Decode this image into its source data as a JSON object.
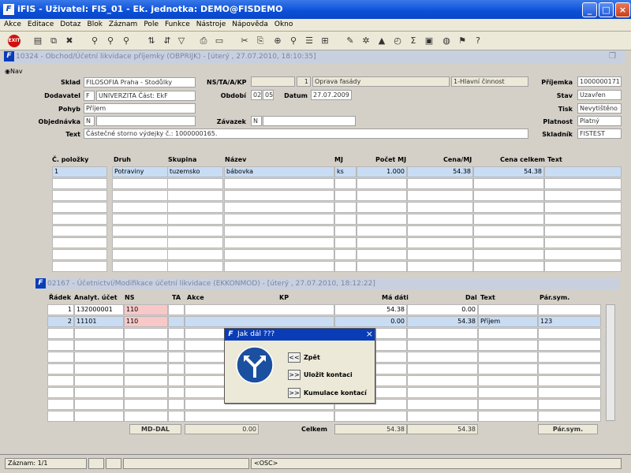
{
  "window": {
    "title": "iFIS - Uživatel: FIS_01 - Ek. jednotka: DEMO@FISDEMO",
    "logo": "F"
  },
  "menu": [
    "Akce",
    "Editace",
    "Dotaz",
    "Blok",
    "Záznam",
    "Pole",
    "Funkce",
    "Nástroje",
    "Nápověda",
    "Okno"
  ],
  "toolbar": {
    "exit_label": "EXIT"
  },
  "form1": {
    "title": "10324 - Obchod/Účetní likvidace příjemky (OBPRIJK) - [úterý , 27.07.2010, 18:10:35]",
    "nav_label": "Nav",
    "fields": {
      "sklad_label": "Sklad",
      "sklad": "FILOSOFIA Praha - Stodůlky",
      "dodavatel_label": "Dodavatel",
      "dodavatel_code": "F",
      "dodavatel": "UNIVERZITA Část: EkF",
      "pohyb_label": "Pohyb",
      "pohyb": "Příjem",
      "objednavka_label": "Objednávka",
      "objednavka_code": "N",
      "text_label": "Text",
      "text": "Částečné storno výdejky č.: 1000000165.",
      "nstaakp_label": "NS/TA/A/KP",
      "nstaakp_num": "1",
      "nstaakp_a": "Oprava fasády",
      "nstaakp_kp": "1-Hlavní činnost",
      "obdobi_label": "Období",
      "obdobi_m": "02",
      "obdobi_y": "05",
      "datum_label": "Datum",
      "datum": "27.07.2009",
      "zavazek_label": "Závazek",
      "zavazek_code": "N",
      "prijemka_label": "Příjemka",
      "prijemka": "1000000171",
      "stav_label": "Stav",
      "stav": "Uzavřen",
      "tisk_label": "Tisk",
      "tisk": "Nevytištěno",
      "platnost_label": "Platnost",
      "platnost": "Platný",
      "skladnik_label": "Skladník",
      "skladnik": "FISTEST"
    },
    "grid_headers": [
      "Č. položky",
      "Druh",
      "Skupina",
      "Název",
      "MJ",
      "Počet MJ",
      "Cena/MJ",
      "Cena celkem",
      "Text"
    ],
    "grid_rows": [
      [
        "1",
        "Potraviny",
        "tuzemsko",
        "bábovka",
        "ks",
        "1.000",
        "54.38",
        "54.38",
        ""
      ]
    ]
  },
  "form2": {
    "title": "02167 - Účetnictví/Modifikace účetní likvidace (EKKONMOD) - [úterý , 27.07.2010, 18:12:22]",
    "grid_headers": [
      "Řádek",
      "Analyt. účet",
      "NS",
      "TA",
      "Akce",
      "KP",
      "Má dáti",
      "Dal",
      "Text",
      "Pár.sym."
    ],
    "grid_rows": [
      [
        "1",
        "132000001",
        "110",
        "",
        "",
        "",
        "54.38",
        "0.00",
        "",
        ""
      ],
      [
        "2",
        "11101",
        "110",
        "",
        "",
        "",
        "0.00",
        "54.38",
        "Příjem",
        "123"
      ]
    ],
    "footer": {
      "mddal_label": "MD-DAL",
      "mddal": "0.00",
      "celkem_label": "Celkem",
      "celkem_md": "54.38",
      "celkem_dal": "54.38",
      "parsym_label": "Pár.sym."
    }
  },
  "dialog": {
    "title": "Jak dál ???",
    "btn_back": "<<",
    "label_back": "Zpět",
    "btn_save": ">>",
    "label_save": "Uložit kontaci",
    "btn_cum": ">>",
    "label_cum": "Kumulace kontací"
  },
  "status": {
    "record": "Záznam: 1/1",
    "mode": "<OSC>"
  }
}
